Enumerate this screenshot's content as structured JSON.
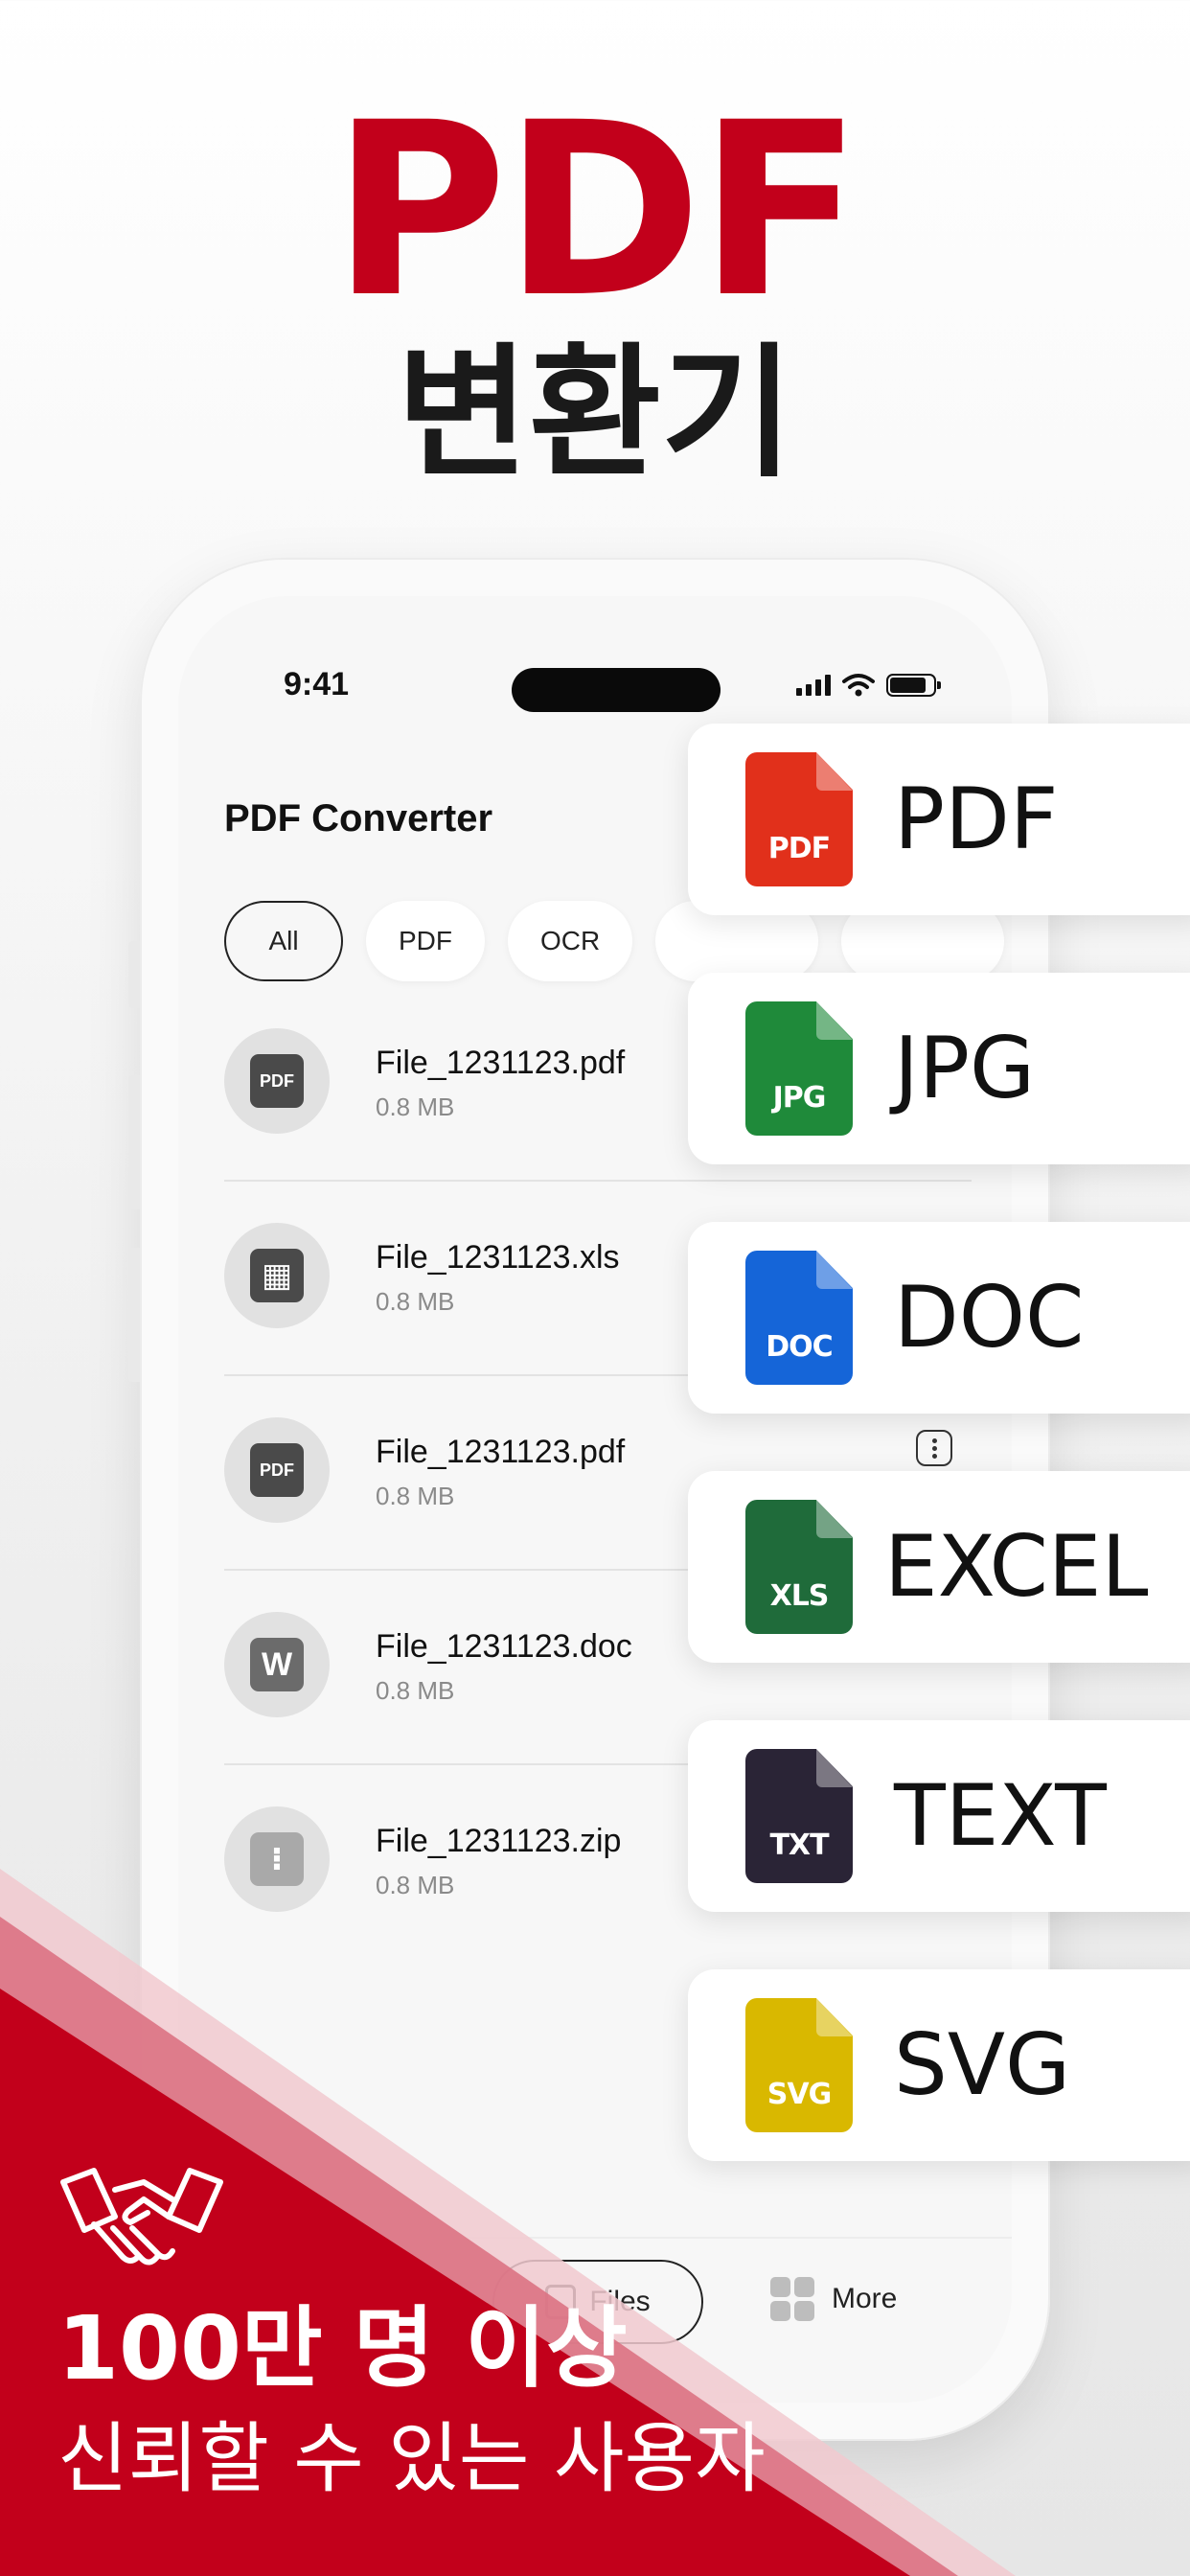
{
  "headline": {
    "title": "PDF",
    "subtitle": "변환기"
  },
  "status_bar": {
    "time": "9:41"
  },
  "app": {
    "title": "PDF Converter"
  },
  "filter_chips": [
    {
      "label": "All"
    },
    {
      "label": "PDF"
    },
    {
      "label": "OCR"
    }
  ],
  "files": [
    {
      "name": "File_1231123.pdf",
      "size": "0.8 MB",
      "icon": "pdf-icon",
      "icon_text": "PDF"
    },
    {
      "name": "File_1231123.xls",
      "size": "0.8 MB",
      "icon": "spreadsheet-icon",
      "icon_text": "▦"
    },
    {
      "name": "File_1231123.pdf",
      "size": "0.8 MB",
      "icon": "pdf-icon",
      "icon_text": "PDF"
    },
    {
      "name": "File_1231123.doc",
      "size": "0.8 MB",
      "icon": "word-icon",
      "icon_text": "W"
    },
    {
      "name": "File_1231123.zip",
      "size": "0.8 MB",
      "icon": "zip-icon",
      "icon_text": "⁝"
    }
  ],
  "bottom_nav": {
    "files": "Files",
    "more": "More"
  },
  "formats": [
    {
      "tag": "PDF",
      "label": "PDF",
      "color": "#e1301b"
    },
    {
      "tag": "JPG",
      "label": "JPG",
      "color": "#1f8a3a"
    },
    {
      "tag": "DOC",
      "label": "DOC",
      "color": "#1565d8"
    },
    {
      "tag": "XLS",
      "label": "EXCEL",
      "color": "#1f6b3a"
    },
    {
      "tag": "TXT",
      "label": "TEXT",
      "color": "#2a2436"
    },
    {
      "tag": "SVG",
      "label": "SVG",
      "color": "#d9b800"
    }
  ],
  "trust": {
    "main": "100만 명 이상",
    "sub": "신뢰할 수 있는 사용자",
    "icon": "handshake-icon"
  },
  "colors": {
    "brand_red": "#c2001b"
  }
}
